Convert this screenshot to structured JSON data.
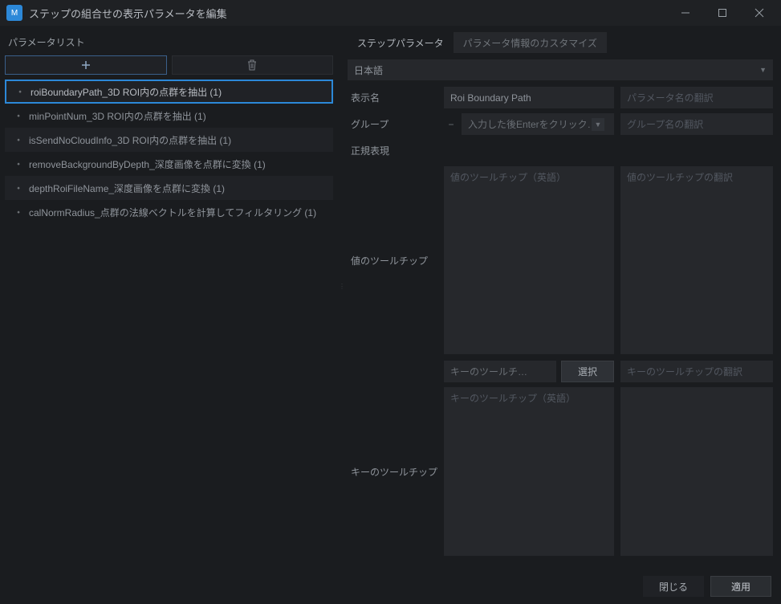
{
  "window": {
    "title": "ステップの組合せの表示パラメータを編集"
  },
  "left": {
    "header": "パラメータリスト",
    "items": [
      {
        "label": "roiBoundaryPath_3D ROI内の点群を抽出 (1)",
        "selected": true
      },
      {
        "label": "minPointNum_3D ROI内の点群を抽出 (1)",
        "selected": false
      },
      {
        "label": "isSendNoCloudInfo_3D ROI内の点群を抽出 (1)",
        "selected": false
      },
      {
        "label": "removeBackgroundByDepth_深度画像を点群に変換 (1)",
        "selected": false
      },
      {
        "label": "depthRoiFileName_深度画像を点群に変換 (1)",
        "selected": false
      },
      {
        "label": "calNormRadius_点群の法線ベクトルを計算してフィルタリング (1)",
        "selected": false
      }
    ]
  },
  "tabs": {
    "step_params": "ステップパラメータ",
    "custom_info": "パラメータ情報のカスタマイズ"
  },
  "language": {
    "value": "日本語"
  },
  "form": {
    "display_name_label": "表示名",
    "display_name_value": "Roi Boundary Path",
    "display_name_tr_placeholder": "パラメータ名の翻訳",
    "group_label": "グループ",
    "group_value": "入力した後Enterをクリック…",
    "group_tr_placeholder": "グループ名の翻訳",
    "regex_label": "正規表現",
    "value_tooltip_label": "値のツールチップ",
    "value_tooltip_en_placeholder": "値のツールチップ（英語）",
    "value_tooltip_tr_placeholder": "値のツールチップの翻訳",
    "key_tooltip_label": "キーのツールチップ",
    "key_tooltip_short": "キーのツールチ…",
    "select_btn": "選択",
    "key_tooltip_tr_placeholder": "キーのツールチップの翻訳",
    "key_tooltip_en_placeholder": "キーのツールチップ（英語）"
  },
  "footer": {
    "close": "閉じる",
    "apply": "適用"
  }
}
